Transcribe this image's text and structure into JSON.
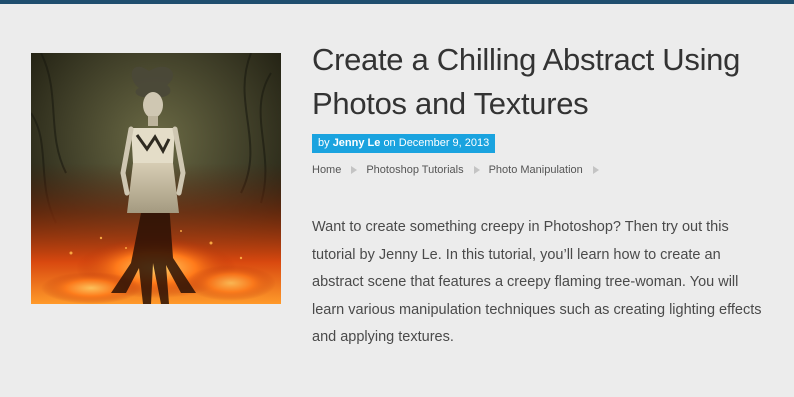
{
  "article": {
    "title": "Create a Chilling Abstract Using Photos and Textures",
    "byline": {
      "prefix": "by",
      "author": "Jenny Le",
      "date_prefix": "on",
      "date": "December 9, 2013"
    },
    "breadcrumb": [
      "Home",
      "Photoshop Tutorials",
      "Photo Manipulation"
    ],
    "excerpt": "Want to create something creepy in Photoshop? Then try out this tutorial by Jenny Le. In this tutorial, you’ll learn how to create an abstract scene that features a creepy flaming tree-woman. You will learn various manipulation techniques such as creating lighting effects and applying textures."
  },
  "colors": {
    "background": "#ececec",
    "top_bar": "#1f4e6e",
    "byline_bg": "#1aa3df",
    "title_text": "#333333",
    "body_text": "#4a4a4a"
  },
  "icons": {
    "breadcrumb_separator": "triangle-right-icon",
    "thumbnail": "flaming-tree-woman-image"
  }
}
